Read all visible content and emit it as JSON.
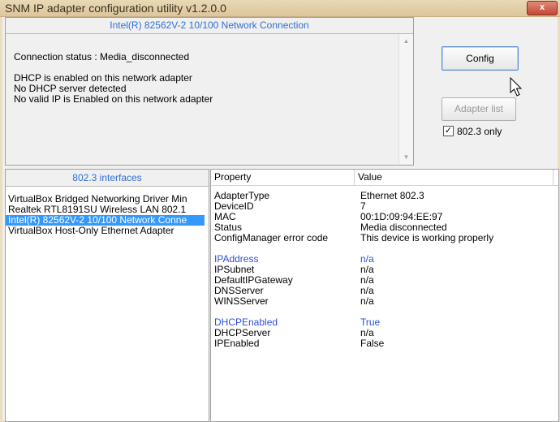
{
  "window": {
    "title": "SNM IP adapter configuration utility v1.2.0.0",
    "close_label": "x"
  },
  "info": {
    "header": "Intel(R) 82562V-2 10/100 Network Connection",
    "lines": [
      "Connection status : Media_disconnected",
      "",
      "DHCP is enabled on this network adapter",
      "No DHCP server detected",
      "No valid IP is Enabled on this network adapter"
    ]
  },
  "buttons": {
    "config": "Config",
    "adapter_list": "Adapter list"
  },
  "checkbox": {
    "label": "802.3 only",
    "checked": true
  },
  "interfaces": {
    "header": "802.3 interfaces",
    "items": [
      "VirtualBox Bridged Networking Driver Min",
      "Realtek RTL8191SU Wireless LAN 802.1",
      "Intel(R) 82562V-2 10/100 Network Conne",
      "VirtualBox Host-Only Ethernet Adapter"
    ],
    "selected_index": 2
  },
  "properties": {
    "col_property": "Property",
    "col_value": "Value",
    "rows": [
      {
        "property": "AdapterType",
        "value": "Ethernet 802.3"
      },
      {
        "property": "DeviceID",
        "value": "7"
      },
      {
        "property": "MAC",
        "value": "00:1D:09:94:EE:97"
      },
      {
        "property": "Status",
        "value": "Media disconnected"
      },
      {
        "property": "ConfigManager error code",
        "value": "This device is working properly"
      },
      {
        "property": "",
        "value": ""
      },
      {
        "property": "IPAddress",
        "value": "n/a",
        "highlight": true
      },
      {
        "property": "IPSubnet",
        "value": "n/a"
      },
      {
        "property": "DefaultIPGateway",
        "value": "n/a"
      },
      {
        "property": "DNSServer",
        "value": "n/a"
      },
      {
        "property": "WINSServer",
        "value": "n/a"
      },
      {
        "property": "",
        "value": ""
      },
      {
        "property": "DHCPEnabled",
        "value": "True",
        "highlight": true
      },
      {
        "property": "DHCPServer",
        "value": "n/a"
      },
      {
        "property": "IPEnabled",
        "value": "False"
      }
    ]
  }
}
